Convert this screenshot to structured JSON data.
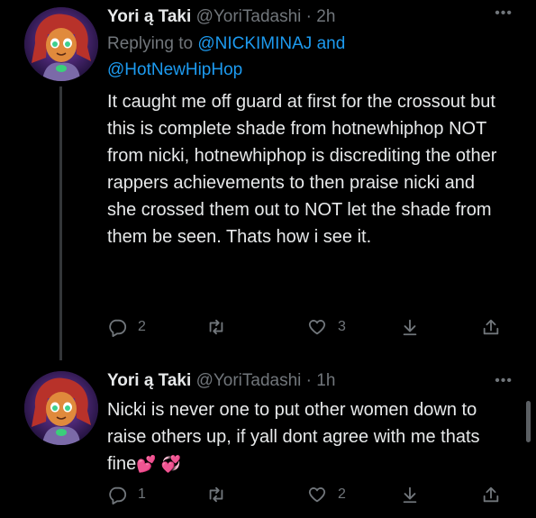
{
  "tweets": [
    {
      "display_name": "Yori ą Taki",
      "handle": "@YoriTadashi",
      "separator": "·",
      "time": "2h",
      "replying_prefix": "Replying to ",
      "replying_user_1": "@NICKIMINAJ",
      "replying_and": " and",
      "replying_user_2": "@HotNewHipHop",
      "text": "It caught me off guard at first for the crossout but this is complete shade from hotnewhiphop NOT from nicki, hotnewhiphop is discrediting the other rappers achievements to then praise nicki and she crossed them out to NOT let the shade from them be seen. Thats how i see it.",
      "more_label": "•••",
      "reply_count": "2",
      "retweet_count": "",
      "like_count": "3"
    },
    {
      "display_name": "Yori ą Taki",
      "handle": "@YoriTadashi",
      "separator": "·",
      "time": "1h",
      "text": "Nicki is never one to put other women down to raise others up, if yall dont agree with me thats fine",
      "emoji": "💕 💞",
      "more_label": "•••",
      "reply_count": "1",
      "retweet_count": "",
      "like_count": "2"
    }
  ],
  "colors": {
    "background": "#000000",
    "text": "#e7e9ea",
    "muted": "#71767b",
    "link": "#1d9bf0"
  },
  "icons": [
    "reply-icon",
    "retweet-icon",
    "like-icon",
    "download-icon",
    "share-icon",
    "more-icon"
  ]
}
